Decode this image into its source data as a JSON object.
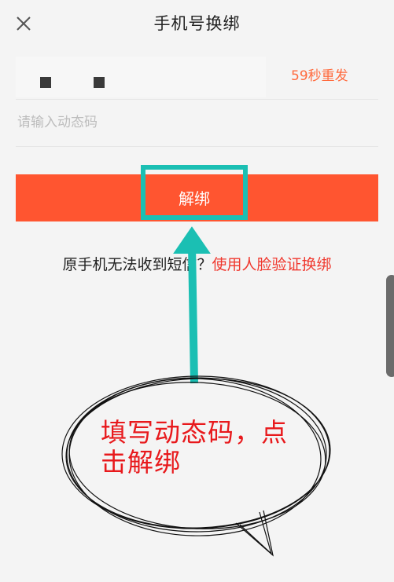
{
  "header": {
    "title": "手机号换绑",
    "close_icon": "close-icon"
  },
  "phone": {
    "masked": "masked phone digits",
    "resend_label": "59秒重发"
  },
  "code_input": {
    "placeholder": "请输入动态码",
    "value": ""
  },
  "unbind_button": {
    "label": "解绑",
    "color": "#ff5530"
  },
  "fallback": {
    "question": "原手机无法收到短信？",
    "link": "使用人脸验证换绑"
  },
  "annotation": {
    "text": "填写动态码，点击解绑",
    "highlight_color": "#1bbfb3",
    "text_color": "#e8191c"
  }
}
